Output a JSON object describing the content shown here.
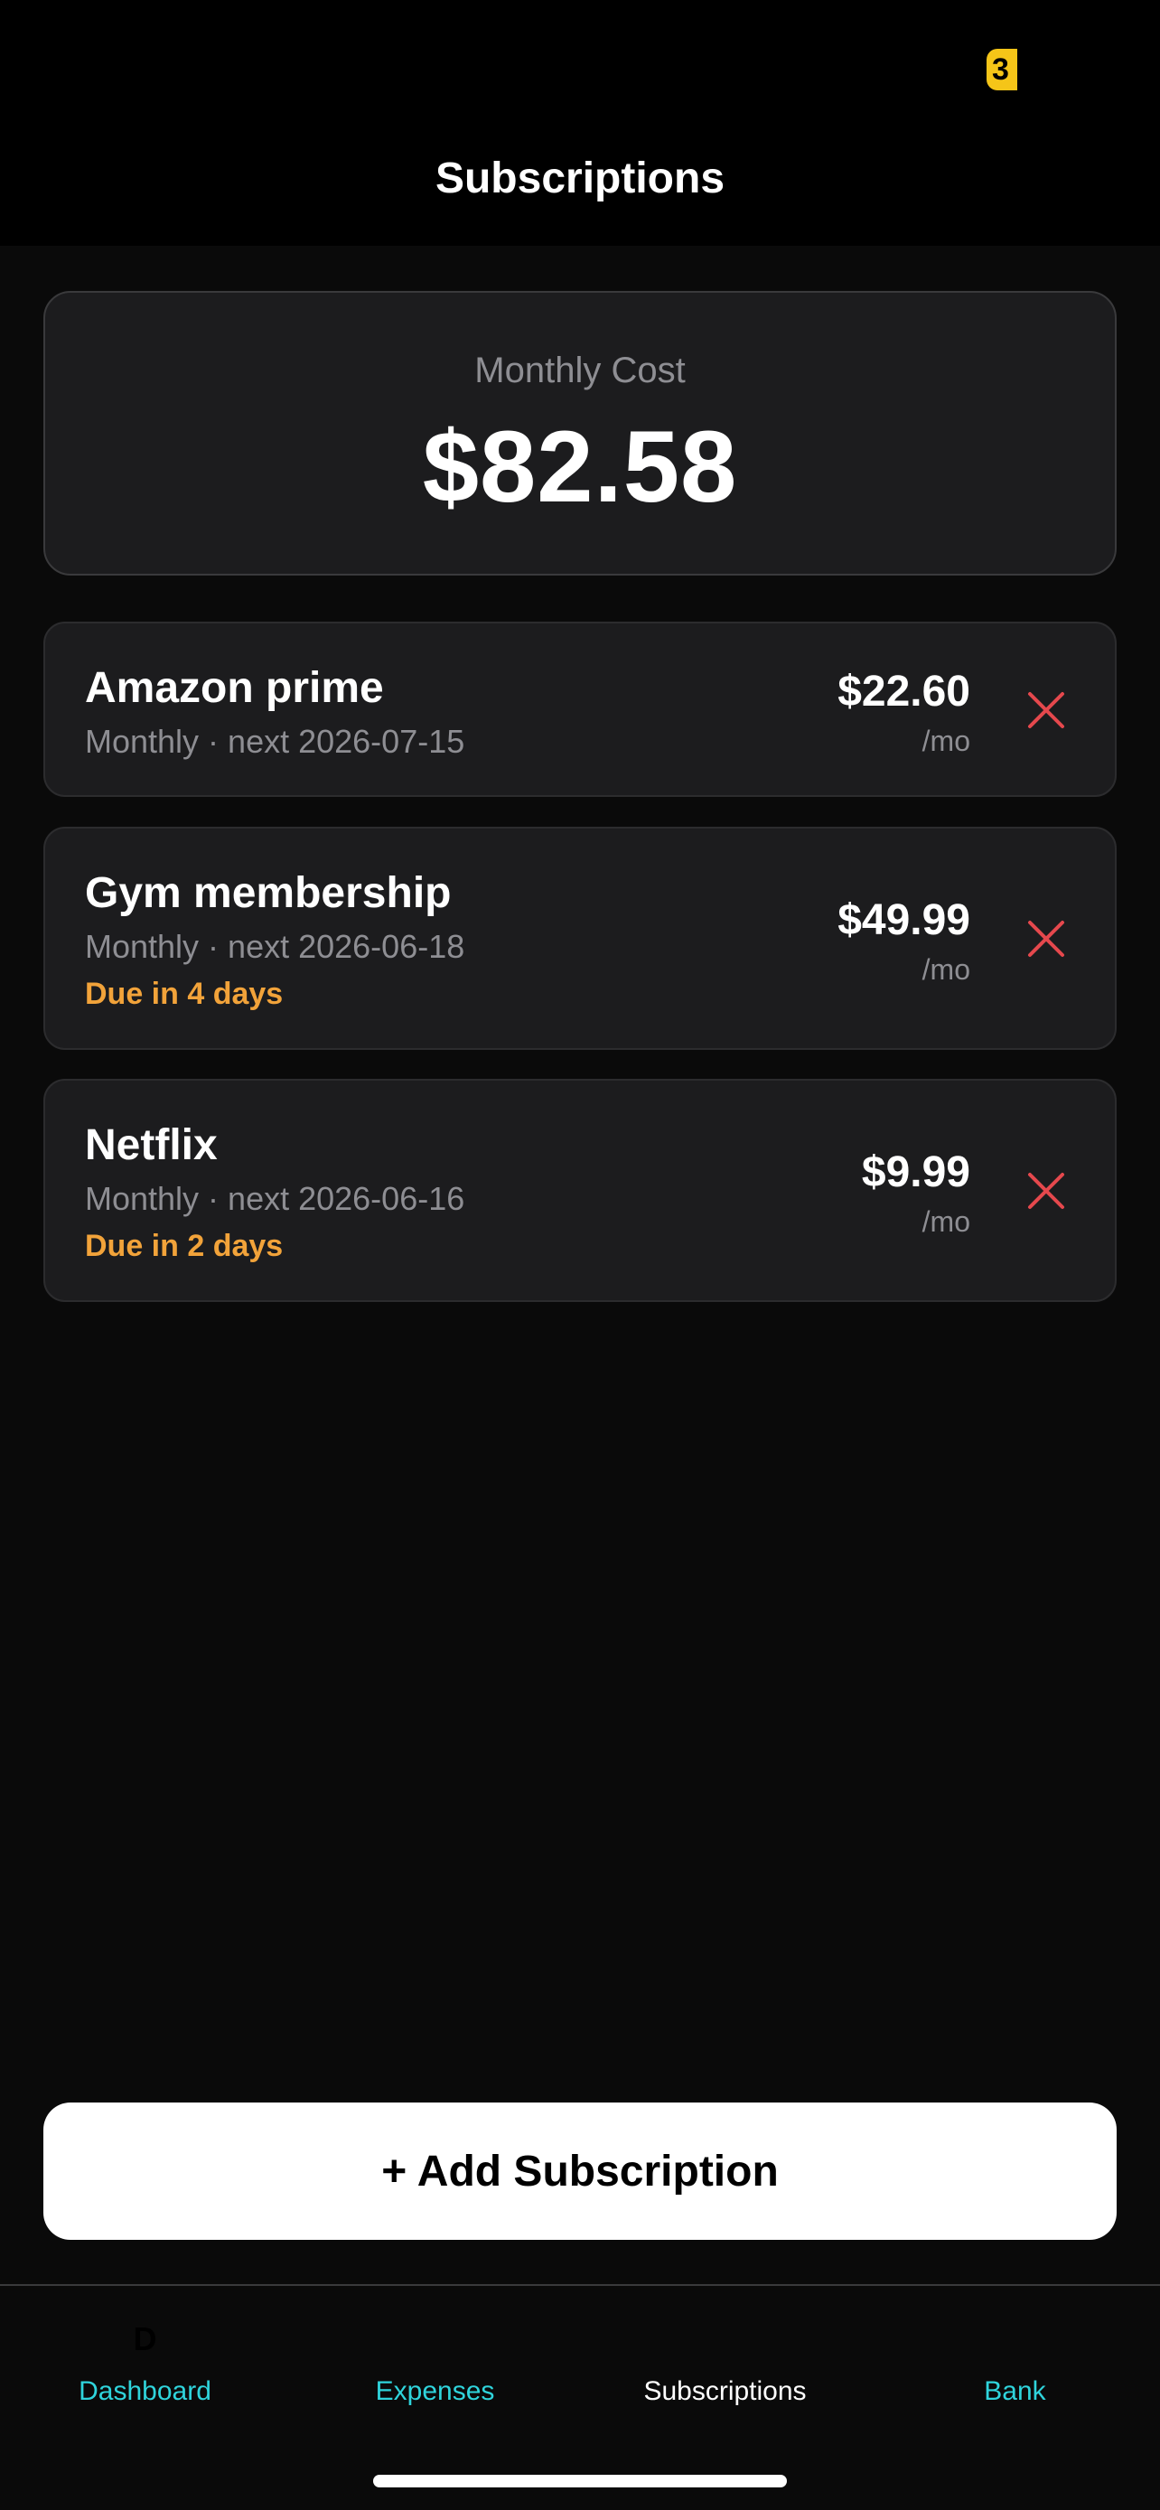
{
  "status": {
    "badge_text": "3"
  },
  "header": {
    "title": "Subscriptions"
  },
  "summary": {
    "label": "Monthly Cost",
    "value": "$82.58"
  },
  "subscriptions": [
    {
      "name": "Amazon prime",
      "meta": "Monthly · next 2026-07-15",
      "due": "",
      "price": "$22.60",
      "period": "/mo"
    },
    {
      "name": "Gym membership",
      "meta": "Monthly · next 2026-06-18",
      "due": "Due in 4 days",
      "price": "$49.99",
      "period": "/mo"
    },
    {
      "name": "Netflix",
      "meta": "Monthly · next 2026-06-16",
      "due": "Due in 2 days",
      "price": "$9.99",
      "period": "/mo"
    }
  ],
  "actions": {
    "add_label": "+ Add Subscription"
  },
  "tabs": [
    {
      "label": "Dashboard",
      "icon_text": "D",
      "active": false
    },
    {
      "label": "Expenses",
      "icon_text": "",
      "active": false
    },
    {
      "label": "Subscriptions",
      "icon_text": "",
      "active": true
    },
    {
      "label": "Bank",
      "icon_text": "",
      "active": false
    }
  ],
  "colors": {
    "background": "#0a0a0a",
    "card": "#1c1c1e",
    "muted_text": "#8e8e93",
    "warning": "#f2a33a",
    "delete": "#e5484d",
    "tab_inactive": "#2fd4dc",
    "badge": "#f5c518"
  }
}
